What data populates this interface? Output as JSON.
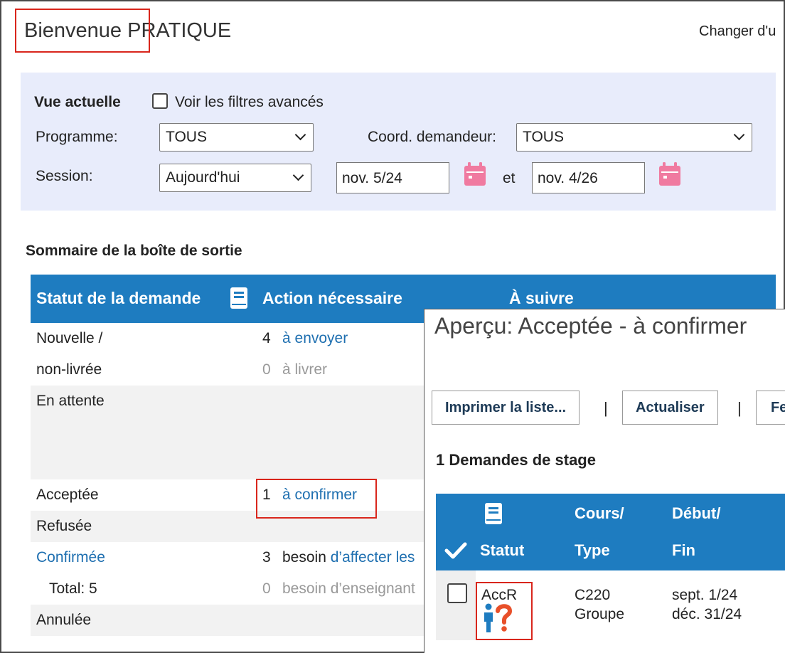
{
  "header": {
    "welcome_word": "Bienvenue",
    "user_name": "PRATIQUE",
    "change_label": "Changer d'u"
  },
  "filters": {
    "current_view_label": "Vue actuelle",
    "advanced_filters_label": "Voir les filtres avancés",
    "program_label": "Programme:",
    "program_value": "TOUS",
    "coordinator_label": "Coord. demandeur:",
    "coordinator_value": "TOUS",
    "session_label": "Session:",
    "session_value": "Aujourd'hui",
    "date_from": "nov. 5/24",
    "and_label": "et",
    "date_to": "nov. 4/26"
  },
  "outbox": {
    "title": "Sommaire de la boîte de sortie",
    "columns": [
      "Statut de la demande",
      "Action nécessaire",
      "À suivre"
    ],
    "rows": {
      "nouvelle_1": "Nouvelle /",
      "nouvelle_2": "non-livrée",
      "send_count": "4",
      "send_label": "à envoyer",
      "deliver_count": "0",
      "deliver_label": "à livrer",
      "en_attente": "En attente",
      "acceptee": "Acceptée",
      "confirm_count": "1",
      "confirm_label": "à confirmer",
      "refusee": "Refusée",
      "confirmee": "Confirmée",
      "assign_count": "3",
      "assign_prefix": "besoin",
      "assign_link": "d’affecter les",
      "total": "Total: 5",
      "teacher_count": "0",
      "teacher_label": "besoin d’enseignant",
      "annulee": "Annulée"
    }
  },
  "preview": {
    "title": "Aperçu: Acceptée - à confirmer",
    "print_button": "Imprimer la liste...",
    "refresh_button": "Actualiser",
    "separator": "|",
    "partial_button": "Fe",
    "count_label": "1 Demandes de stage",
    "headers": {
      "status": "Statut",
      "course_1": "Cours/",
      "course_2": "Type",
      "start_1": "Début/",
      "start_2": "Fin"
    },
    "row": {
      "status_code": "AccR",
      "course": "C220",
      "type": "Groupe",
      "start": "sept. 1/24",
      "end": "déc. 31/24"
    }
  },
  "colors": {
    "table_header": "#1e7cc0",
    "filter_panel": "#e8ecfb",
    "highlight_box": "#d9261c",
    "link": "#1e6fb0",
    "calendar_icon": "#f07aa0",
    "person_icon": "#1e7cc0",
    "question_icon": "#e8502a"
  },
  "icons": [
    "book-icon",
    "calendar-icon",
    "chevron-down-icon",
    "checkmark-icon",
    "person-question-icon"
  ]
}
